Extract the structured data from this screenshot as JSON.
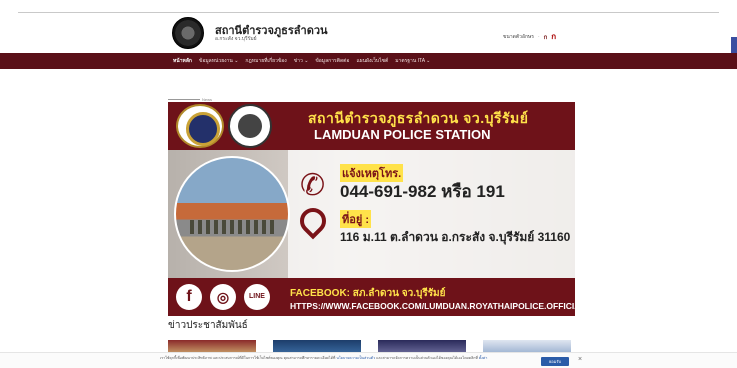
{
  "header": {
    "title": "สถานีตำรวจภูธรลำดวน",
    "subtitle": "อ.กระสัง จว.บุรีรัมย์",
    "font_size_label": "ขนาดตัวอักษร",
    "font_small": "ก",
    "font_large": "ก"
  },
  "nav": {
    "items": [
      {
        "label": "หน้าหลัก",
        "active": true
      },
      {
        "label": "ข้อมูลหน่วยงาน ⌄"
      },
      {
        "label": "กฎหมายที่เกี่ยวข้อง"
      },
      {
        "label": "ข่าว ⌄"
      },
      {
        "label": "ข้อมูลการติดต่อ"
      },
      {
        "label": "แผนผังเว็บไซต์"
      },
      {
        "label": "มาตรฐาน ITA ⌄"
      }
    ]
  },
  "news_tag": "News",
  "banner": {
    "title_thai": "สถานีตำรวจภูธรลำดวน จว.บุรีรัมย์",
    "title_eng": "LAMDUAN POLICE STATION",
    "report_label": "แจ้งเหตุโทร.",
    "phone": "044-691-982 หรือ 191",
    "address_label": "ที่อยู่ :",
    "address": "116 ม.11 ต.ลำดวน อ.กระสัง จ.บุรีรัมย์ 31160",
    "facebook_label": "FACEBOOK: สภ.ลำดวน จว.บุรีรัมย์",
    "facebook_url": "HTTPS://WWW.FACEBOOK.COM/LUMDUAN.ROYATHAIPOLICE.OFFICIAL",
    "social": [
      "f",
      "◎",
      "LINE"
    ]
  },
  "section_title": "ข่าวประชาสัมพันธ์",
  "cookie": {
    "text": "เราใช้คุกกี้เพื่อพัฒนาประสิทธิภาพ และประสบการณ์ที่ดีในการใช้เว็บไซต์ของคุณ คุณสามารถศึกษารายละเอียดได้ที่",
    "link": "นโยบายความเป็นส่วนตัว",
    "text2": "และสามารถจัดการความเป็นส่วนตัวเองได้ของคุณได้เองโดยคลิกที่",
    "link2": "ตั้งค่า",
    "accept": "ยอมรับ",
    "close": "×"
  },
  "colors": {
    "brand": "#5a1018",
    "banner_red": "#6e1219",
    "highlight": "#ffe24a",
    "accept_blue": "#2b5ca8"
  }
}
